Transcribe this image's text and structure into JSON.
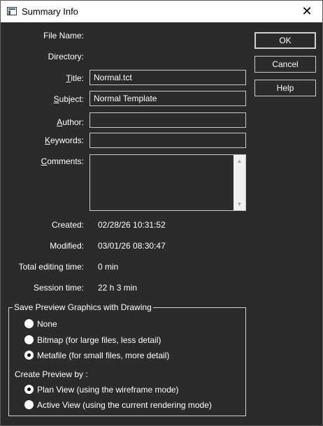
{
  "window": {
    "title": "Summary Info",
    "close_glyph": "✕"
  },
  "labels": {
    "file_name": "File Name:",
    "directory": "Directory:",
    "title_first": "T",
    "title_rest": "itle:",
    "subject_first": "S",
    "subject_rest": "ubject:",
    "author_first": "A",
    "author_rest": "uthor:",
    "keywords_first": "K",
    "keywords_rest": "eywords:",
    "comments_first": "C",
    "comments_rest": "omments:",
    "created": "Created:",
    "modified": "Modified:",
    "total_editing": "Total editing time:",
    "session_time": "Session time:"
  },
  "fields": {
    "title": "Normal.tct",
    "subject": "Normal Template",
    "author": "",
    "keywords": "",
    "comments": ""
  },
  "info": {
    "created": "02/28/26  10:31:52",
    "modified": "03/01/26  08:30:47",
    "total_editing": "0 min",
    "session_time": "22 h 3 min"
  },
  "buttons": {
    "ok": "OK",
    "cancel": "Cancel",
    "help": "Help"
  },
  "preview": {
    "group_label": "Save Preview Graphics with Drawing",
    "options": [
      {
        "label": "None",
        "selected": false
      },
      {
        "label": "Bitmap (for large files, less detail)",
        "selected": false
      },
      {
        "label": "Metafile (for small files, more detail)",
        "selected": true
      }
    ],
    "create_label": "Create Preview by :",
    "create_options": [
      {
        "label": "Plan View (using the wireframe mode)",
        "selected": true
      },
      {
        "label": "Active View (using the current rendering mode)",
        "selected": false
      }
    ]
  },
  "icons": {
    "app": "app-icon",
    "close": "close-icon",
    "scroll_up": "scroll-up-icon",
    "scroll_down": "scroll-down-icon"
  }
}
